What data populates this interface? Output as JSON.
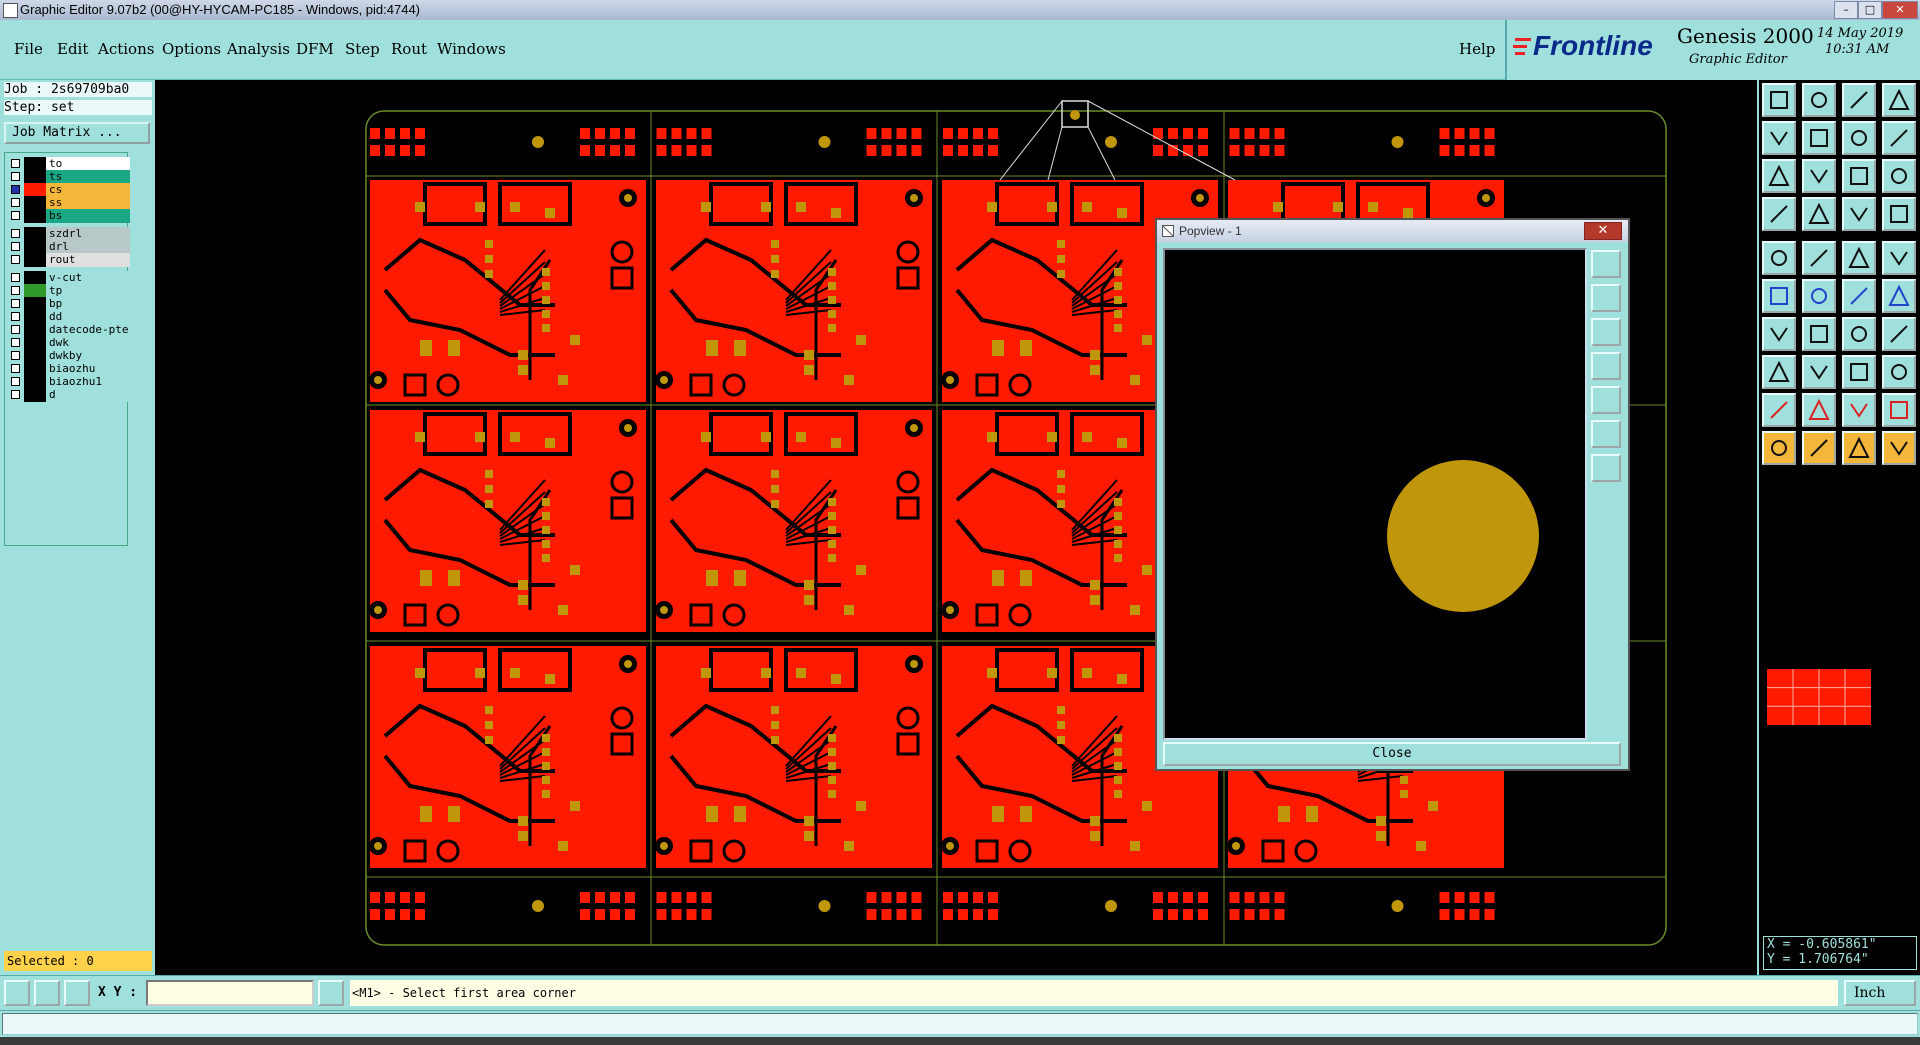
{
  "window": {
    "title": "Graphic Editor 9.07b2 (00@HY-HYCAM-PC185 - Windows, pid:4744)",
    "controls": [
      "–",
      "□",
      "✕"
    ]
  },
  "menu": [
    "File",
    "Edit",
    "Actions",
    "Options",
    "Analysis",
    "DFM",
    "Step",
    "Rout",
    "Windows"
  ],
  "help": "Help",
  "brand": {
    "logo": "Frontline",
    "product": "Genesis 2000",
    "subtitle": "Graphic Editor",
    "date": "14 May 2019",
    "time": "10:31 AM"
  },
  "job": {
    "job_line": "Job : 2s69709ba0",
    "step_line": "Step: set",
    "matrix_button": "Job Matrix ..."
  },
  "layers": [
    {
      "name": "to",
      "color": "#ffffff",
      "swatch": "#000000",
      "group": 0
    },
    {
      "name": "ts",
      "color": "#1aa884",
      "swatch": "#000000",
      "group": 0
    },
    {
      "name": "cs",
      "color": "#f5b63c",
      "swatch": "#ff1a00",
      "group": 0,
      "active": true
    },
    {
      "name": "ss",
      "color": "#f5b63c",
      "swatch": "#000000",
      "group": 0
    },
    {
      "name": "bs",
      "color": "#1aa884",
      "swatch": "#000000",
      "group": 0
    },
    {
      "name": "szdrl",
      "color": "#b8c8c8",
      "swatch": "#000000",
      "group": 1
    },
    {
      "name": "drl",
      "color": "#b8c8c8",
      "swatch": "#000000",
      "group": 1
    },
    {
      "name": "rout",
      "color": "#e0e0e0",
      "swatch": "#000000",
      "group": 1
    },
    {
      "name": "v-cut",
      "color": "#9fe0dc",
      "swatch": "#000000",
      "group": 2
    },
    {
      "name": "tp",
      "color": "#9fe0dc",
      "swatch": "#2f9a2a",
      "group": 2
    },
    {
      "name": "bp",
      "color": "#9fe0dc",
      "swatch": "#000000",
      "group": 2
    },
    {
      "name": "dd",
      "color": "#9fe0dc",
      "swatch": "#000000",
      "group": 2
    },
    {
      "name": "datecode-pte",
      "color": "#9fe0dc",
      "swatch": "#000000",
      "group": 2
    },
    {
      "name": "dwk",
      "color": "#9fe0dc",
      "swatch": "#000000",
      "group": 2
    },
    {
      "name": "dwkby",
      "color": "#9fe0dc",
      "swatch": "#000000",
      "group": 2
    },
    {
      "name": "biaozhu",
      "color": "#9fe0dc",
      "swatch": "#000000",
      "group": 2
    },
    {
      "name": "biaozhu1",
      "color": "#9fe0dc",
      "swatch": "#000000",
      "group": 2
    },
    {
      "name": "d",
      "color": "#9fe0dc",
      "swatch": "#000000",
      "group": 2
    }
  ],
  "selected": "Selected : 0",
  "popview": {
    "title": "Popview - 1",
    "close_label": "Close"
  },
  "coords": {
    "x": "X = -0.605861\"",
    "y": "Y =  1.706764\""
  },
  "status": {
    "xy_label": "X Y :",
    "xy_value": "",
    "message": "<M1> - Select first area corner",
    "units": "Inch"
  },
  "colors": {
    "panel": "#9fe0dc",
    "copper": "#ff1a00",
    "pad": "#c0960a",
    "board_outline": "#6a8a2a"
  },
  "tool_icons": [
    "zoom-home-icon",
    "zoom-fit-icon",
    "home-icon",
    "split-icon",
    "pan-left-icon",
    "pan-right-icon",
    "zoom-window-icon",
    "redraw-icon",
    "fit-icon",
    "center-icon",
    "scale-icon",
    "query-icon",
    "measure-icon",
    "pad-icon",
    "net-icon",
    "drill-icon",
    "snap-icon",
    "angle-icon",
    "ruler-icon",
    "dot-icon",
    "add-line-icon",
    "delete-icon",
    "connect-icon",
    "break-icon",
    "arc-icon",
    "line-icon",
    "rotate-icon",
    "mirror-icon",
    "move-icon",
    "resize-icon",
    "align-icon",
    "copy-icon",
    "triangle-icon",
    "polygon-icon",
    "surface-icon",
    "outline-icon",
    "select-icon",
    "select-area-icon",
    "select-net-icon",
    "select-route-icon"
  ]
}
